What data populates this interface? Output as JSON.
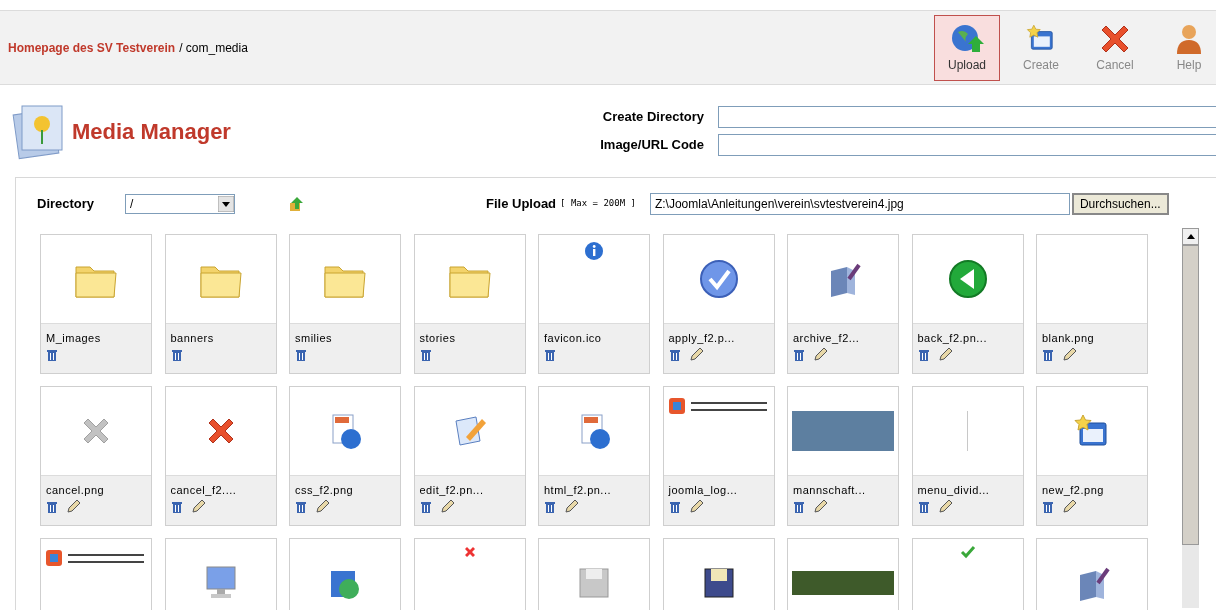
{
  "header": {
    "site_link": "Homepage des SV Testverein",
    "path": "/ com_media"
  },
  "toolbar": [
    {
      "kind": "upload",
      "label": "Upload",
      "selected": true
    },
    {
      "kind": "create",
      "label": "Create",
      "selected": false
    },
    {
      "kind": "cancel",
      "label": "Cancel",
      "selected": false
    },
    {
      "kind": "help",
      "label": "Help",
      "selected": false
    }
  ],
  "title": "Media Manager",
  "create_directory": {
    "label": "Create Directory"
  },
  "image_url_code": {
    "label": "Image/URL Code"
  },
  "directory": {
    "label": "Directory",
    "value": "/"
  },
  "file_upload": {
    "label": "File Upload",
    "hint": "[ Max = 200M ]",
    "value": "Z:\\Joomla\\Anleitungen\\verein\\svtestverein4.jpg",
    "browse_button": "Durchsuchen..."
  },
  "files": [
    {
      "name": "M_images",
      "kind": "folder",
      "editable": false
    },
    {
      "name": "banners",
      "kind": "folder",
      "editable": false
    },
    {
      "name": "smilies",
      "kind": "folder",
      "editable": false
    },
    {
      "name": "stories",
      "kind": "folder",
      "editable": false
    },
    {
      "name": "favicon.ico",
      "kind": "info",
      "editable": false
    },
    {
      "name": "apply_f2.p...",
      "kind": "check",
      "editable": true
    },
    {
      "name": "archive_f2...",
      "kind": "archive",
      "editable": true
    },
    {
      "name": "back_f2.pn...",
      "kind": "back",
      "editable": true
    },
    {
      "name": "blank.png",
      "kind": "blank",
      "editable": true
    },
    {
      "name": "cancel.png",
      "kind": "grayx",
      "editable": true
    },
    {
      "name": "cancel_f2....",
      "kind": "redx",
      "editable": true
    },
    {
      "name": "css_f2.png",
      "kind": "css",
      "editable": true
    },
    {
      "name": "edit_f2.pn...",
      "kind": "edit",
      "editable": true
    },
    {
      "name": "html_f2.pn...",
      "kind": "html",
      "editable": true
    },
    {
      "name": "joomla_log...",
      "kind": "logo",
      "editable": true
    },
    {
      "name": "mannschaft...",
      "kind": "photo",
      "editable": true
    },
    {
      "name": "menu_divid...",
      "kind": "divider",
      "editable": true
    },
    {
      "name": "new_f2.png",
      "kind": "create",
      "editable": true
    },
    {
      "kind": "logo"
    },
    {
      "kind": "monitor"
    },
    {
      "kind": "globe"
    },
    {
      "kind": "smallx"
    },
    {
      "kind": "floppygray"
    },
    {
      "kind": "floppy"
    },
    {
      "kind": "wide"
    },
    {
      "kind": "smallcheck"
    },
    {
      "kind": "archive"
    }
  ]
}
